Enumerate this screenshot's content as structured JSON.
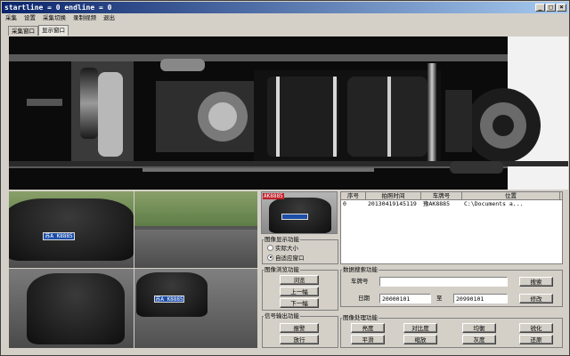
{
  "window": {
    "title": "startline = 0 endline = 0"
  },
  "menu": [
    "采集",
    "设置",
    "采集切换",
    "录制视频",
    "退出"
  ],
  "tabs": [
    "采集窗口",
    "显示窗口"
  ],
  "photos": {
    "overlay_plate": "AK8885",
    "plate_front": "苏A K8885",
    "plate_thumb": "苏A K8885"
  },
  "display_group": {
    "title": "图像显示功能",
    "options": [
      "实际大小",
      "自适应窗口"
    ],
    "selected_index": 1
  },
  "browse_group": {
    "title": "图像浏览功能",
    "buttons": [
      "浏览",
      "上一幅",
      "下一幅"
    ]
  },
  "signal_group": {
    "title": "信号输出功能",
    "buttons": [
      "报警",
      "放行"
    ]
  },
  "table": {
    "columns": [
      "序号",
      "拍照时间",
      "车牌号",
      "位置"
    ],
    "rows": [
      [
        "0",
        "20130419145119",
        "豫AK8885",
        "C:\\Documents a..."
      ]
    ]
  },
  "search": {
    "title": "数据搜索功能",
    "plate_label": "车牌号",
    "date_label": "日期",
    "to_label": "至",
    "plate_value": "",
    "date_from": "20000101",
    "date_to": "20990101",
    "search_button": "搜索",
    "modify_button": "修改"
  },
  "processing": {
    "title": "图像处理功能",
    "buttons": [
      "亮度",
      "对比度",
      "均衡",
      "锐化",
      "平滑",
      "缩放",
      "灰度",
      "还原"
    ]
  }
}
